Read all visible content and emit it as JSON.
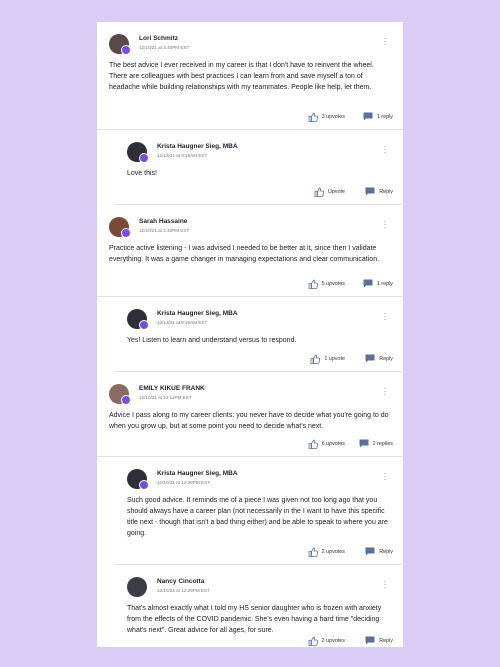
{
  "colors": {
    "page_bg": "#d9ccf5",
    "badge": "#7a4ddc",
    "icon": "#5b6f9a"
  },
  "comments": [
    {
      "author": "Lori Schmitz",
      "time": "12/10/21 at 3:40PM EST",
      "text": "The best advice I ever received in my career  is that I don't have to reinvent the wheel.  There are colleagues with best practices I can learn from and save myself a ton of headache while building relationships with my teammates.  People like help, let them.",
      "upvote_label": "3 upvotes",
      "reply_label": "1 reply",
      "avatar_color": "#5a4a4a"
    },
    {
      "author": "Krista Haugner Sieg, MBA",
      "time": "12/13/21 at 9:15AM EST",
      "text": "Love this!",
      "upvote_label": "Upvote",
      "reply_label": "Reply",
      "avatar_color": "#2f2f3a"
    },
    {
      "author": "Sarah Hassaine",
      "time": "12/10/21 at 2:42PM EST",
      "text": "Practice active listening - I was advised I needed to be better at it, since then I validate everything. It was a game changer in managing expectations and clear communication.",
      "upvote_label": "5 upvotes",
      "reply_label": "1 reply",
      "avatar_color": "#7a4a35"
    },
    {
      "author": "Krista Haugner Sieg, MBA",
      "time": "12/13/21 at 9:15AM EST",
      "text": "Yes!  Listen to learn and understand versus to respond.",
      "upvote_label": "1 upvote",
      "reply_label": "Reply",
      "avatar_color": "#2f2f3a"
    },
    {
      "author": "EMILY KIKUE FRANK",
      "time": "12/10/21 at 12:11PM EST",
      "text": "Advice I pass along to my career clients: you never have to decide what you're going to do when you grow up, but at some point you need to decide what's next.",
      "upvote_label": "6 upvotes",
      "reply_label": "2 replies",
      "avatar_color": "#8a6b63"
    },
    {
      "author": "Krista Haugner Sieg, MBA",
      "time": "12/10/21 at 12:36PM EST",
      "text": "Such good advice.  It reminds me of a piece I was given not too long ago that you should always have a career plan (not necessarily in the I want to have this specific title next - though that isn't a bad thing either) and be able to speak to where you are going.",
      "upvote_label": "2 upvotes",
      "reply_label": "Reply",
      "avatar_color": "#2f2f3a"
    },
    {
      "author": "Nancy Cincotta",
      "time": "12/10/21 at 12:25PM EST",
      "text": "That's almost exactly what I told my HS senior daughter who is frozen with anxiety from the effects of the COVID pandemic. She's even having a hard time \"deciding what's next\". Great advice for all ages, for sure.",
      "upvote_label": "2 upvotes",
      "reply_label": "Reply",
      "avatar_color": "#3c3c46"
    }
  ]
}
